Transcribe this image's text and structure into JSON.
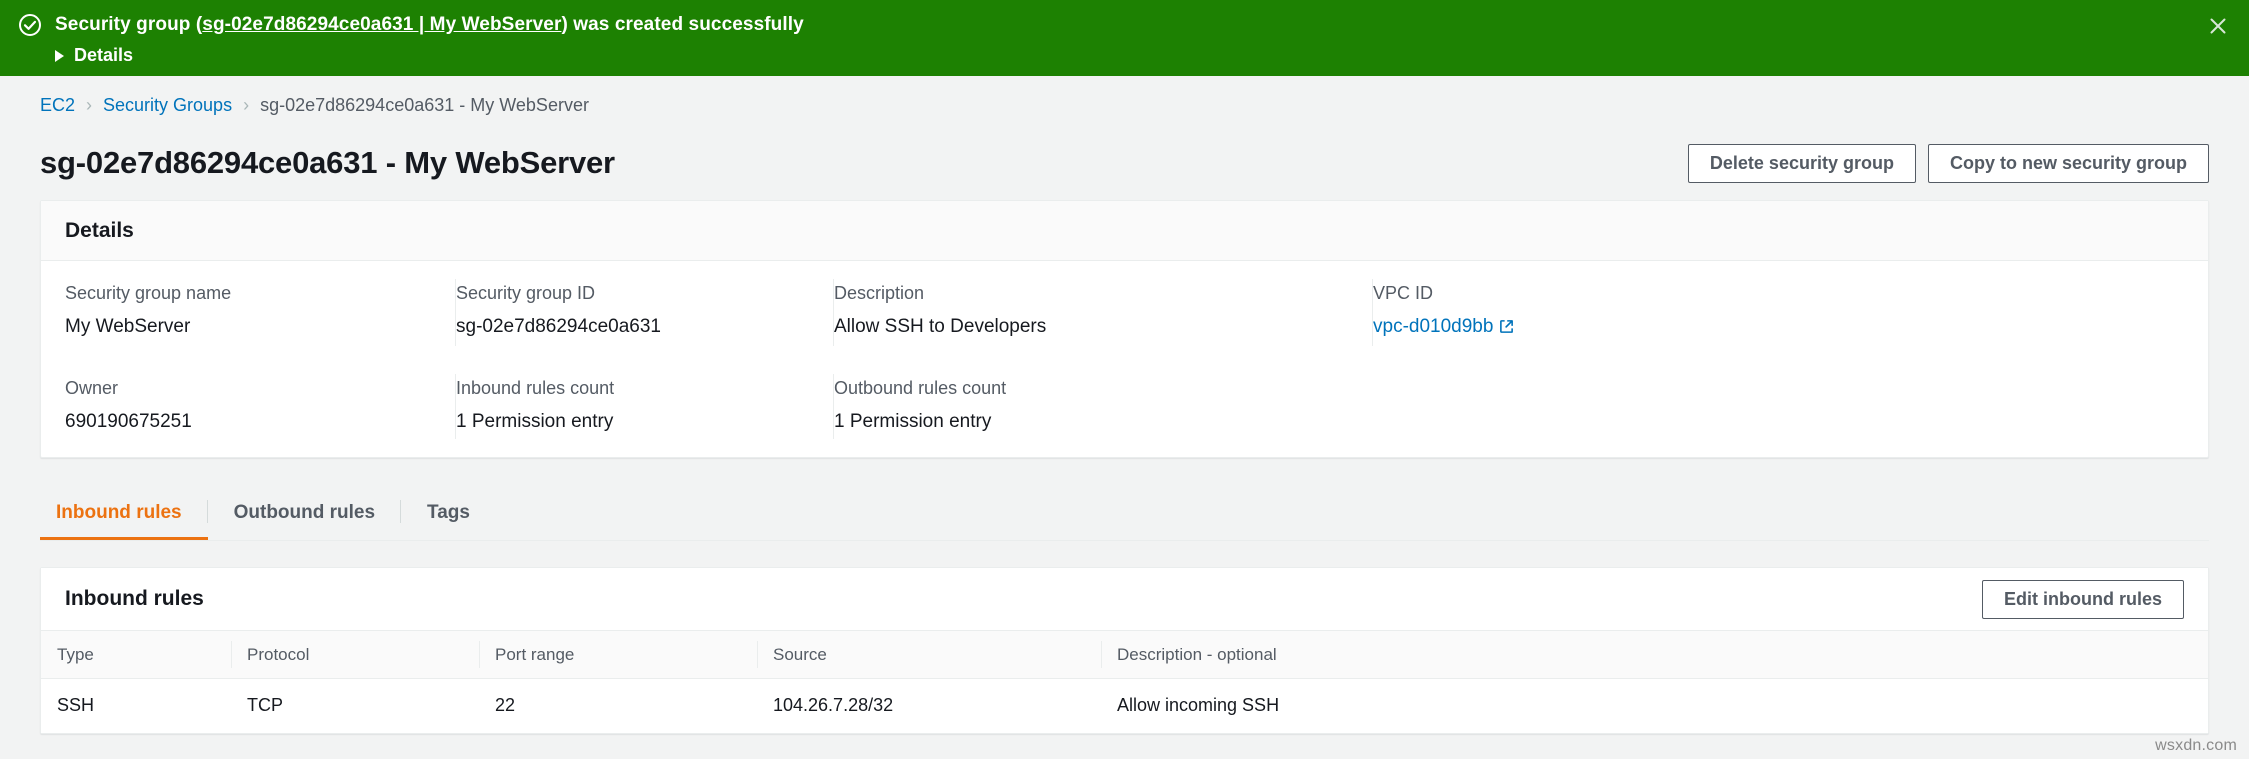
{
  "banner": {
    "icon": "circle-check-icon",
    "text_before": "Security group (",
    "link_text": "sg-02e7d86294ce0a631 | My WebServer",
    "text_after": ") was created successfully",
    "details_label": "Details",
    "close_icon": "close-icon",
    "background_color": "#1d8102"
  },
  "breadcrumb": {
    "items": [
      {
        "label": "EC2",
        "is_link": true
      },
      {
        "label": "Security Groups",
        "is_link": true
      },
      {
        "label": "sg-02e7d86294ce0a631 - My WebServer",
        "is_link": false
      }
    ],
    "separator": "›"
  },
  "header": {
    "title": "sg-02e7d86294ce0a631 - My WebServer",
    "delete_button": "Delete security group",
    "copy_button": "Copy to new security group"
  },
  "details": {
    "panel_title": "Details",
    "fields": [
      {
        "label": "Security group name",
        "value": "My WebServer"
      },
      {
        "label": "Security group ID",
        "value": "sg-02e7d86294ce0a631"
      },
      {
        "label": "Description",
        "value": "Allow SSH to Developers"
      },
      {
        "label": "VPC ID",
        "value": "vpc-d010d9bb",
        "is_link": true,
        "icon": "external-link-icon"
      },
      {
        "label": "Owner",
        "value": "690190675251"
      },
      {
        "label": "Inbound rules count",
        "value": "1 Permission entry"
      },
      {
        "label": "Outbound rules count",
        "value": "1 Permission entry"
      }
    ]
  },
  "tabs": [
    {
      "label": "Inbound rules",
      "active": true
    },
    {
      "label": "Outbound rules",
      "active": false
    },
    {
      "label": "Tags",
      "active": false
    }
  ],
  "rules_section": {
    "title": "Inbound rules",
    "edit_button": "Edit inbound rules",
    "columns": [
      "Type",
      "Protocol",
      "Port range",
      "Source",
      "Description - optional"
    ],
    "rows": [
      {
        "type": "SSH",
        "protocol": "TCP",
        "port_range": "22",
        "source": "104.26.7.28/32",
        "description": "Allow incoming SSH"
      }
    ]
  },
  "watermark": "wsxdn.com",
  "colors": {
    "success_green": "#1d8102",
    "link_blue": "#0073bb",
    "active_tab_orange": "#ec7211",
    "page_background": "#f2f3f3",
    "text_secondary": "#545b64"
  }
}
